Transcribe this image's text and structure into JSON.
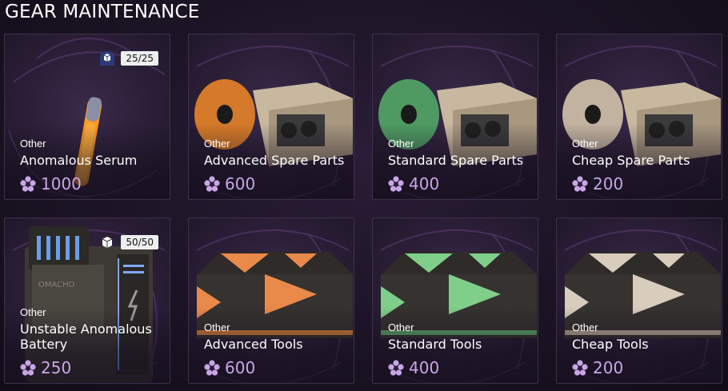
{
  "section": {
    "title": "GEAR MAINTENANCE"
  },
  "colors": {
    "currency": "#c9a6e8",
    "text": "#ffffff",
    "card_border": "#3e3149"
  },
  "items": [
    {
      "category": "Other",
      "name": "Anomalous Serum",
      "price": "1000",
      "stock": "25/25",
      "icon": "anomalous-serum-vial-icon"
    },
    {
      "category": "Other",
      "name": "Advanced Spare Parts",
      "price": "600",
      "icon": "spare-parts-box-orange-icon"
    },
    {
      "category": "Other",
      "name": "Standard Spare Parts",
      "price": "400",
      "icon": "spare-parts-box-green-icon"
    },
    {
      "category": "Other",
      "name": "Cheap Spare Parts",
      "price": "200",
      "icon": "spare-parts-box-beige-icon"
    },
    {
      "category": "Other",
      "name": "Unstable Anomalous Battery",
      "price": "250",
      "stock": "50/50",
      "icon": "battery-icon"
    },
    {
      "category": "Other",
      "name": "Advanced Tools",
      "price": "600",
      "icon": "toolbox-orange-icon"
    },
    {
      "category": "Other",
      "name": "Standard Tools",
      "price": "400",
      "icon": "toolbox-green-icon"
    },
    {
      "category": "Other",
      "name": "Cheap Tools",
      "price": "200",
      "icon": "toolbox-beige-icon"
    }
  ]
}
